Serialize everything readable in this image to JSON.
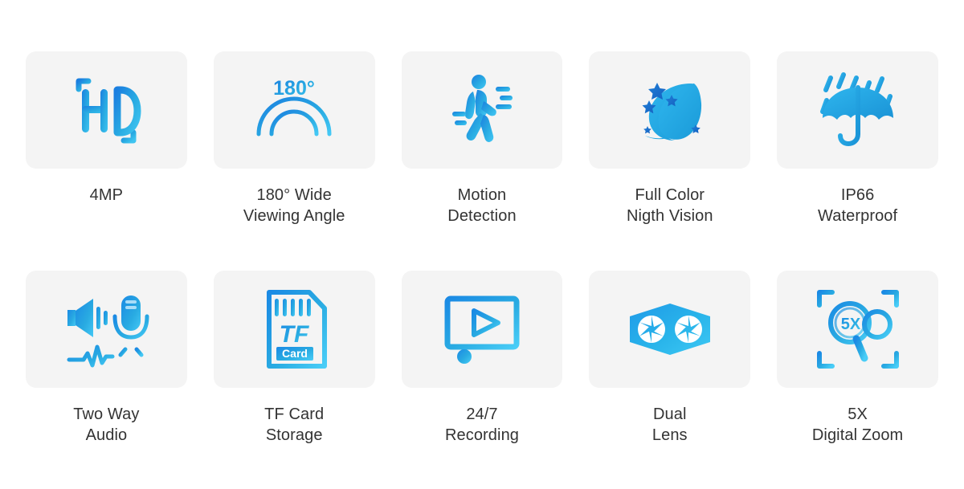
{
  "page": {
    "background_color": "#ffffff",
    "card_background_color": "#f4f4f4",
    "label_color": "#333333",
    "accent_color_light": "#29abe2",
    "accent_color_dark": "#1b6fd0"
  },
  "features": [
    {
      "id": "4mp",
      "icon": "hd-icon",
      "icon_text": "HD",
      "label": "4MP"
    },
    {
      "id": "wide-viewing-angle",
      "icon": "wide-angle-icon",
      "icon_text": "180°",
      "label": "180° Wide\nViewing Angle"
    },
    {
      "id": "motion-detection",
      "icon": "walking-person-motion-icon",
      "icon_text": "",
      "label": "Motion\nDetection"
    },
    {
      "id": "full-color-night-vision",
      "icon": "moon-stars-icon",
      "icon_text": "",
      "label": "Full Color\nNigth Vision"
    },
    {
      "id": "ip66-waterproof",
      "icon": "umbrella-rain-icon",
      "icon_text": "",
      "label": "IP66\nWaterproof"
    },
    {
      "id": "two-way-audio",
      "icon": "speaker-microphone-icon",
      "icon_text": "",
      "label": "Two Way\nAudio"
    },
    {
      "id": "tf-card-storage",
      "icon": "tf-card-icon",
      "icon_text": "TF",
      "icon_subtext": "Card",
      "label": "TF Card\nStorage"
    },
    {
      "id": "24-7-recording",
      "icon": "video-player-icon",
      "icon_text": "",
      "label": "24/7\nRecording"
    },
    {
      "id": "dual-lens",
      "icon": "dual-lens-icon",
      "icon_text": "",
      "label": "Dual\nLens"
    },
    {
      "id": "5x-digital-zoom",
      "icon": "magnifier-zoom-icon",
      "icon_text": "5X",
      "label": "5X\nDigital Zoom"
    }
  ]
}
